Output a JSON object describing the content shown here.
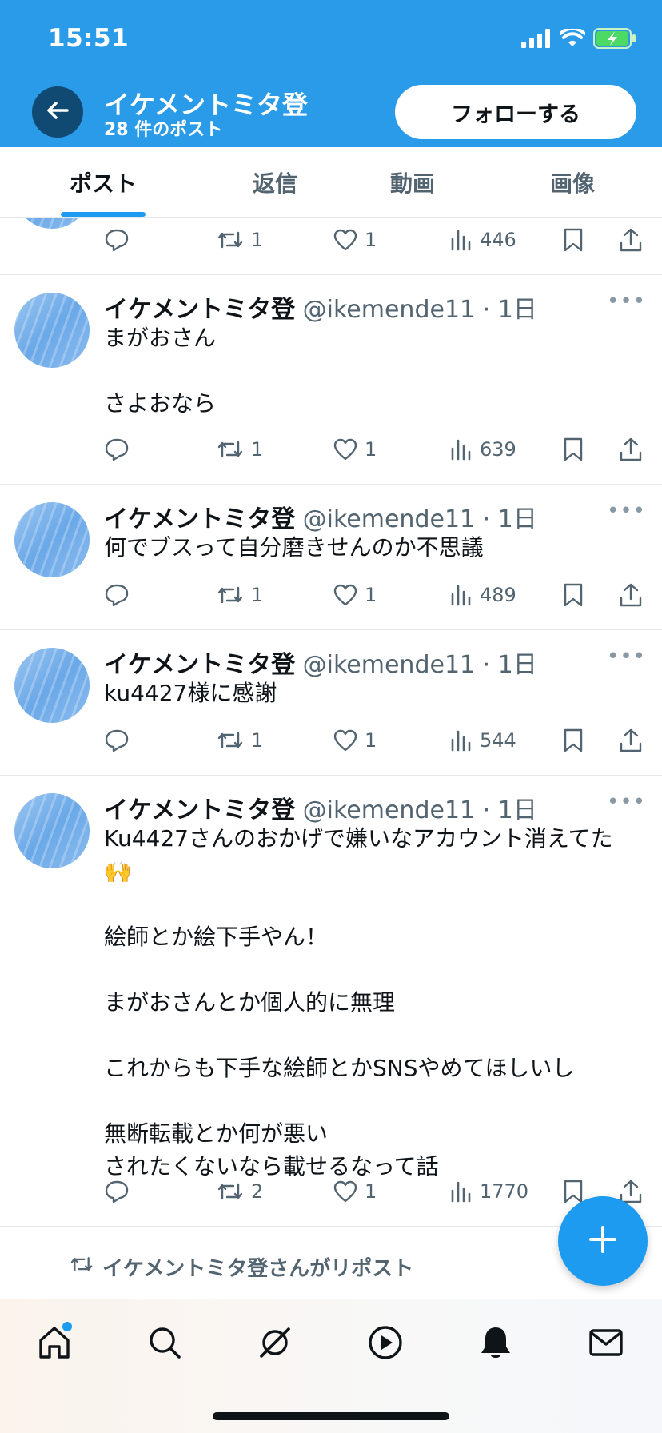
{
  "status": {
    "time": "15:51"
  },
  "header": {
    "profile_name": "イケメントミタ登",
    "post_count": "28 件のポスト",
    "follow_label": "フォローする"
  },
  "tabs": [
    {
      "label": "ポスト",
      "active": true
    },
    {
      "label": "返信",
      "active": false
    },
    {
      "label": "動画",
      "active": false
    },
    {
      "label": "画像",
      "active": false
    }
  ],
  "partial_post": {
    "reposts": "1",
    "likes": "1",
    "views": "446"
  },
  "posts": [
    {
      "name": "イケメントミタ登",
      "handle": "@ikemende11",
      "time": "1日",
      "meta": "@ikemende11 · 1日",
      "text": "まがおさん\n\nさよおなら",
      "replies": "",
      "reposts": "1",
      "likes": "1",
      "views": "639"
    },
    {
      "name": "イケメントミタ登",
      "handle": "@ikemende11",
      "time": "1日",
      "meta": "@ikemende11 · 1日",
      "text": "何でブスって自分磨きせんのか不思議",
      "replies": "",
      "reposts": "1",
      "likes": "1",
      "views": "489"
    },
    {
      "name": "イケメントミタ登",
      "handle": "@ikemende11",
      "time": "1日",
      "meta": "@ikemende11 · 1日",
      "text": "ku4427様に感謝",
      "replies": "",
      "reposts": "1",
      "likes": "1",
      "views": "544"
    },
    {
      "name": "イケメントミタ登",
      "handle": "@ikemende11",
      "time": "1日",
      "meta": "@ikemende11 · 1日",
      "text": "Ku4427さんのおかげで嫌いなアカウント消えてた🙌\n\n絵師とか絵下手やん！\n\nまがおさんとか個人的に無理\n\nこれからも下手な絵師とかSNSやめてほしいし\n\n無断転載とか何が悪い\nされたくないなら載せるなって話",
      "replies": "",
      "reposts": "2",
      "likes": "1",
      "views": "1770"
    }
  ],
  "repost_note": "イケメントミタ登さんがリポスト",
  "icons": {
    "back": "back-arrow-icon",
    "reply": "reply-icon",
    "repost": "repost-icon",
    "like": "heart-icon",
    "views": "views-icon",
    "bookmark": "bookmark-icon",
    "share": "share-icon",
    "compose": "plus-icon",
    "nav": [
      "home-icon",
      "search-icon",
      "grok-icon",
      "video-icon",
      "notifications-icon",
      "messages-icon"
    ]
  },
  "colors": {
    "header": "#2a9be8",
    "accent": "#1d9bf0",
    "muted": "#536471"
  }
}
